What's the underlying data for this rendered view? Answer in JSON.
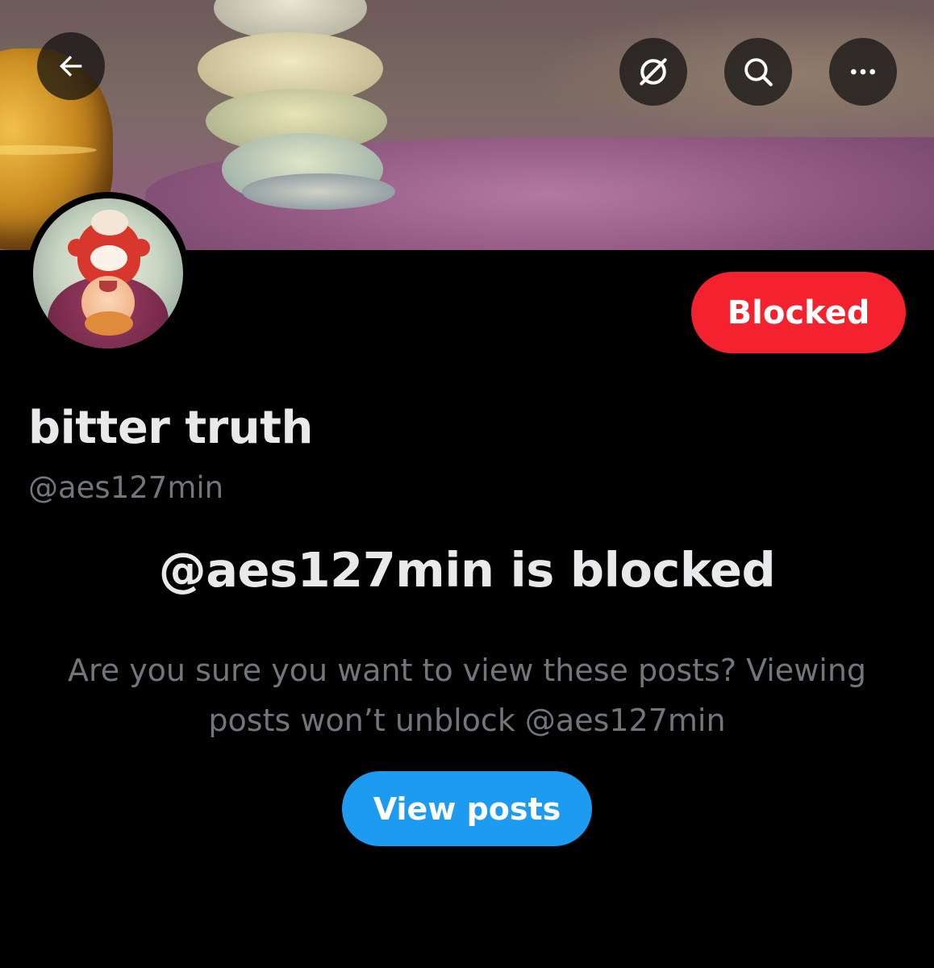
{
  "header": {
    "back_icon": "arrow-left-icon",
    "grok_icon": "grok-icon",
    "search_icon": "search-icon",
    "more_icon": "more-horizontal-icon"
  },
  "profile": {
    "display_name": "bitter truth",
    "handle": "@aes127min",
    "blocked_button_label": "Blocked",
    "blocked_button_color": "#f4212e"
  },
  "blocked_notice": {
    "title": "@aes127min is blocked",
    "description": "Are you sure you want to view these posts? Viewing posts won’t unblock @aes127min",
    "view_posts_label": "View posts",
    "view_posts_color": "#1d9bf0"
  },
  "colors": {
    "background": "#000000",
    "primary_text": "#e7e9ea",
    "secondary_text": "#71767b"
  }
}
